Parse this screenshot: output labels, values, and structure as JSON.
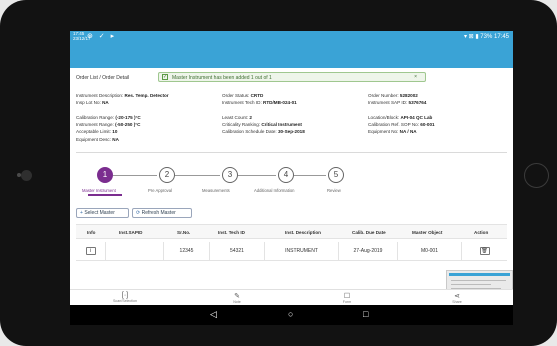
{
  "status_bar": {
    "time_left_1": "17:45",
    "time_left_2": "23/12/17",
    "battery": "73%",
    "clock": "17:45"
  },
  "breadcrumb": {
    "parent": "Order List",
    "separator": "/",
    "current": "Order Detail"
  },
  "toast": {
    "message": "Master Instrument has been added 1 out of 1",
    "close": "×"
  },
  "details": {
    "col1": [
      {
        "label": "Instrument Description:",
        "value": "Res. Temp. Detector"
      },
      {
        "label": "Insp Lot No:",
        "value": "NA"
      },
      {
        "label": "",
        "value": ""
      },
      {
        "label": "Calibration Range:",
        "value": "(-20-175 )°C"
      },
      {
        "label": "Instrument Range:",
        "value": "(-50-250 )°C"
      },
      {
        "label": "Acceptable Limit:",
        "value": "10"
      },
      {
        "label": "Equipment Desc:",
        "value": "NA"
      }
    ],
    "col2": [
      {
        "label": "Order Status:",
        "value": "CRTD"
      },
      {
        "label": "Instrument Tech ID:",
        "value": "RTD/MB-024-01"
      },
      {
        "label": "",
        "value": ""
      },
      {
        "label": "Least Count:",
        "value": "2"
      },
      {
        "label": "Criticality Ranking:",
        "value": "Critical Instrument"
      },
      {
        "label": "Calibration Schedule Date:",
        "value": "30-Sep-2018"
      }
    ],
    "col3": [
      {
        "label": "Order Number:",
        "value": "5282002"
      },
      {
        "label": "Instrument SAP ID:",
        "value": "5376764"
      },
      {
        "label": "",
        "value": ""
      },
      {
        "label": "Location/Block:",
        "value": "API-04 QC Lab"
      },
      {
        "label": "Calibration Ref. SOP No:",
        "value": "60-001"
      },
      {
        "label": "Equipment No:",
        "value": "NA / NA"
      }
    ]
  },
  "steps": [
    {
      "number": "1",
      "label": "Master Instrument",
      "active": true
    },
    {
      "number": "2",
      "label": "Pre Approval",
      "active": false
    },
    {
      "number": "3",
      "label": "Measurements",
      "active": false
    },
    {
      "number": "4",
      "label": "Additional Information",
      "active": false
    },
    {
      "number": "5",
      "label": "Review",
      "active": false
    }
  ],
  "actions": {
    "select_master": "Select Master",
    "refresh_master": "Refresh Master"
  },
  "table": {
    "headers": [
      "Info",
      "Inst.SAPID",
      "Sr.No.",
      "Inst. Tech ID",
      "Inst. Description",
      "Calib. Due Date",
      "Master Object",
      "Action"
    ],
    "rows": [
      {
        "info": "i",
        "sapid": "",
        "srno": "12345",
        "tech_id": "54321",
        "description": "INSTRUMENT",
        "due_date": "27-Aug-2019",
        "master_object": "M0-001",
        "action": "delete"
      }
    ]
  },
  "bottom_nav": [
    {
      "icon": "scan-icon",
      "glyph": "[·]",
      "label": "Scan/Selection"
    },
    {
      "icon": "pencil-icon",
      "glyph": "✎",
      "label": "Note"
    },
    {
      "icon": "checklist-icon",
      "glyph": "☐",
      "label": "Form"
    },
    {
      "icon": "share-icon",
      "glyph": "⋖",
      "label": "Share"
    }
  ],
  "nav_bar": {
    "back": "◁",
    "home": "○",
    "recent": "□"
  },
  "colors": {
    "accent": "#3aa3d6",
    "step_active": "#7b2d8f",
    "toast_bg": "#eef5ea"
  }
}
